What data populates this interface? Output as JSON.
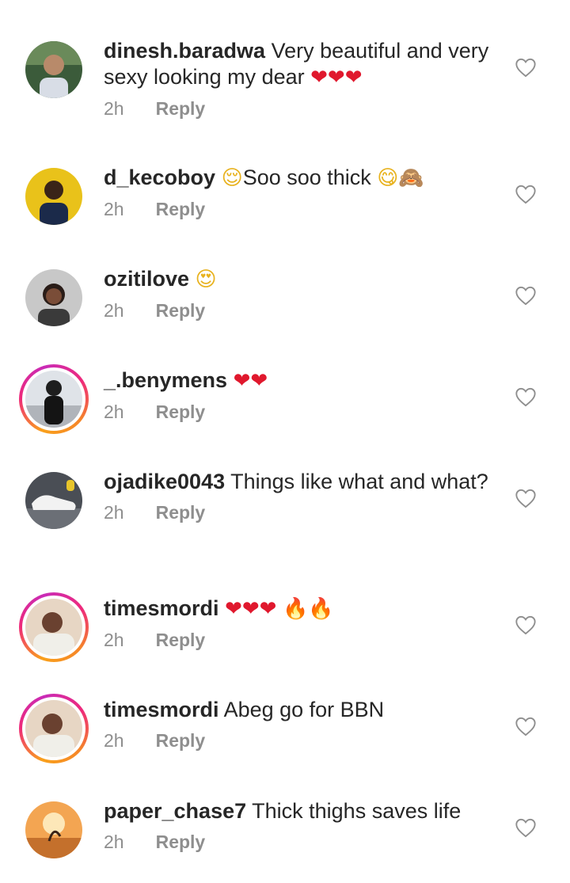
{
  "comments": [
    {
      "username": "dinesh.baradwa",
      "text": "Very beautiful and very sexy looking my dear",
      "emoji": "❤❤❤",
      "time": "2h",
      "reply_label": "Reply",
      "avatar_icon": "man-avatar-icon",
      "has_story_ring": false
    },
    {
      "username": "d_kecoboy",
      "text": "Soo soo thick",
      "emoji_prefix": "😌",
      "emoji": "😋🙈",
      "time": "2h",
      "reply_label": "Reply",
      "avatar_icon": "boy-avatar-icon",
      "has_story_ring": false
    },
    {
      "username": "ozitilove",
      "text": "",
      "emoji": "😍",
      "time": "2h",
      "reply_label": "Reply",
      "avatar_icon": "woman-avatar-icon",
      "has_story_ring": false
    },
    {
      "username": "_.benymens",
      "text": "",
      "emoji": "❤❤",
      "time": "2h",
      "reply_label": "Reply",
      "avatar_icon": "person-avatar-icon",
      "has_story_ring": true
    },
    {
      "username": "ojadike0043",
      "text": "Things like what and what?",
      "emoji": "",
      "time": "2h",
      "reply_label": "Reply",
      "avatar_icon": "sneaker-avatar-icon",
      "has_story_ring": false
    },
    {
      "username": "timesmordi",
      "text": "",
      "emoji": "❤❤❤",
      "emoji_suffix": "🔥🔥",
      "time": "2h",
      "reply_label": "Reply",
      "avatar_icon": "man-avatar-icon",
      "has_story_ring": true
    },
    {
      "username": "timesmordi",
      "text": "Abeg go for BBN",
      "emoji": "",
      "time": "2h",
      "reply_label": "Reply",
      "avatar_icon": "man-avatar-icon",
      "has_story_ring": true
    },
    {
      "username": "paper_chase7",
      "text": "Thick thighs saves life",
      "emoji": "",
      "time": "2h",
      "reply_label": "Reply",
      "avatar_icon": "sunset-avatar-icon",
      "has_story_ring": false
    }
  ],
  "colors": {
    "text": "#262626",
    "muted": "#8e8e8e",
    "heart_outline": "#8e8e8e"
  }
}
